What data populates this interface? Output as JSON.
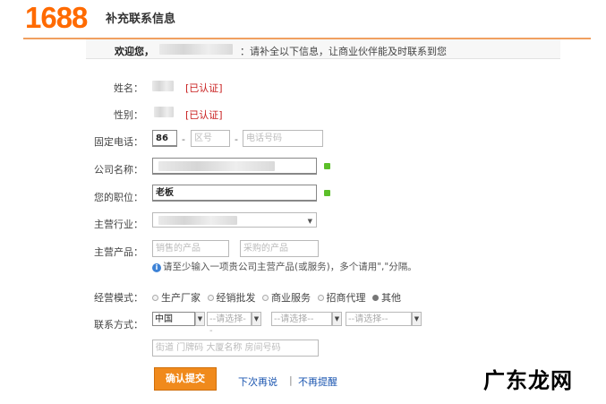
{
  "header": {
    "logo": "1688",
    "title": "补充联系信息"
  },
  "welcome": {
    "label": "欢迎您，",
    "message": "：请补全以下信息，让商业伙伴能及时联系到您"
  },
  "form": {
    "name": {
      "label": "姓名：",
      "status": "[已认证]"
    },
    "gender": {
      "label": "性别：",
      "status": "[已认证]"
    },
    "phone": {
      "label": "固定电话：",
      "country_code": "86",
      "dash": "-",
      "area_placeholder": "区号",
      "number_placeholder": "电话号码"
    },
    "company": {
      "label": "公司名称："
    },
    "position": {
      "label": "您的职位：",
      "value": "老板"
    },
    "industry": {
      "label": "主营行业："
    },
    "products": {
      "label": "主营产品：",
      "sell_placeholder": "销售的产品",
      "buy_placeholder": "采购的产品",
      "hint": "请至少输入一项贵公司主营产品(或服务)，多个请用\",\"分隔。"
    },
    "business_mode": {
      "label": "经营模式：",
      "options": [
        "生产厂家",
        "经销批发",
        "商业服务",
        "招商代理",
        "其他"
      ],
      "selected": 4
    },
    "contact": {
      "label": "联系方式：",
      "country": "中国",
      "province": "--请选择--",
      "city": "--请选择--",
      "district": "--请选择--",
      "address_placeholder": "街道 门牌码 大厦名称 房间号码"
    }
  },
  "actions": {
    "submit": "确认提交",
    "later": "下次再说",
    "separator": "|",
    "no_remind": "不再提醒"
  },
  "watermark": "广东龙网",
  "colors": {
    "brand": "#ff6a00",
    "submit": "#f08a1c",
    "verified": "#c81e1e",
    "link": "#1a55b0",
    "ok": "#5cbf2a"
  }
}
